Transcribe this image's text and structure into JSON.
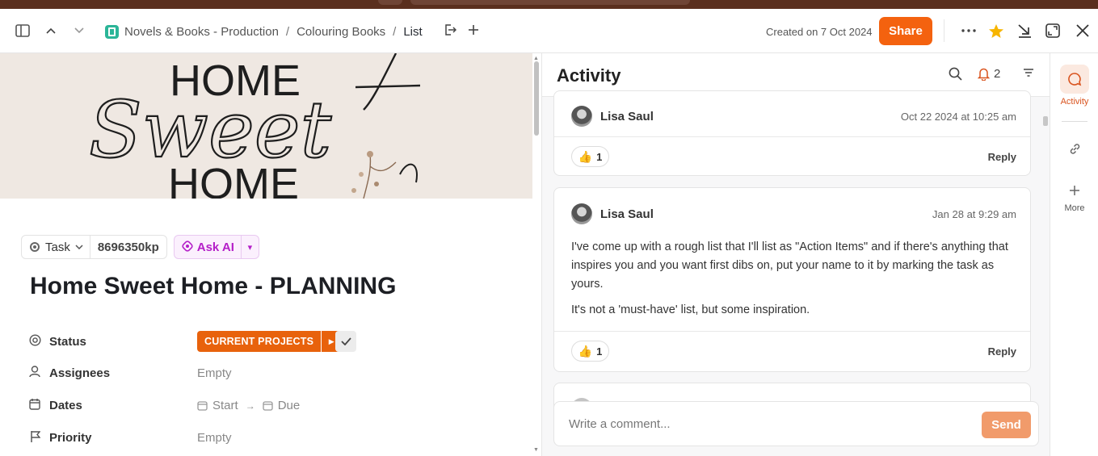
{
  "header": {
    "breadcrumbs": [
      "Novels & Books - Production",
      "Colouring Books",
      "List"
    ],
    "breadcrumb_sep": "/",
    "created": "Created on 7 Oct 2024",
    "share_label": "Share",
    "icons": [
      "sidebar-toggle-icon",
      "chevron-up-icon",
      "chevron-down-icon",
      "space-icon",
      "move-icon",
      "plus-icon",
      "more-icon",
      "star-icon",
      "minimize-icon",
      "expand-icon",
      "close-icon"
    ],
    "accent": "#f4620f"
  },
  "cover": {
    "line1": "HOME",
    "line2": "Sweet",
    "line3": "HOME"
  },
  "task": {
    "type_label": "Task",
    "id": "8696350kp",
    "ask_ai_label": "Ask AI",
    "title": "Home Sweet Home - PLANNING",
    "fields": {
      "status": {
        "label": "Status",
        "value": "CURRENT PROJECTS",
        "color": "#e8620c"
      },
      "assignees": {
        "label": "Assignees",
        "value": "Empty"
      },
      "dates": {
        "label": "Dates",
        "start": "Start",
        "due": "Due"
      },
      "priority": {
        "label": "Priority",
        "value": "Empty"
      }
    }
  },
  "activity": {
    "title": "Activity",
    "notification_count": "2",
    "comments": [
      {
        "user": "Lisa Saul",
        "time": "Oct 22 2024 at 10:25 am",
        "reaction_count": "1",
        "reply_label": "Reply"
      },
      {
        "user": "Lisa Saul",
        "time": "Jan 28 at 9:29 am",
        "body": [
          "I've come up with a rough list that I'll list as \"Action Items\" and if there's anything that inspires you and you want first dibs on, put your name to it by marking the task as yours.",
          "It's not a 'must-have' list, but some inspiration."
        ],
        "reaction_count": "1",
        "reply_label": "Reply"
      }
    ],
    "comment_placeholder": "Write a comment...",
    "send_label": "Send"
  },
  "rail": {
    "activity_label": "Activity",
    "more_label": "More"
  }
}
